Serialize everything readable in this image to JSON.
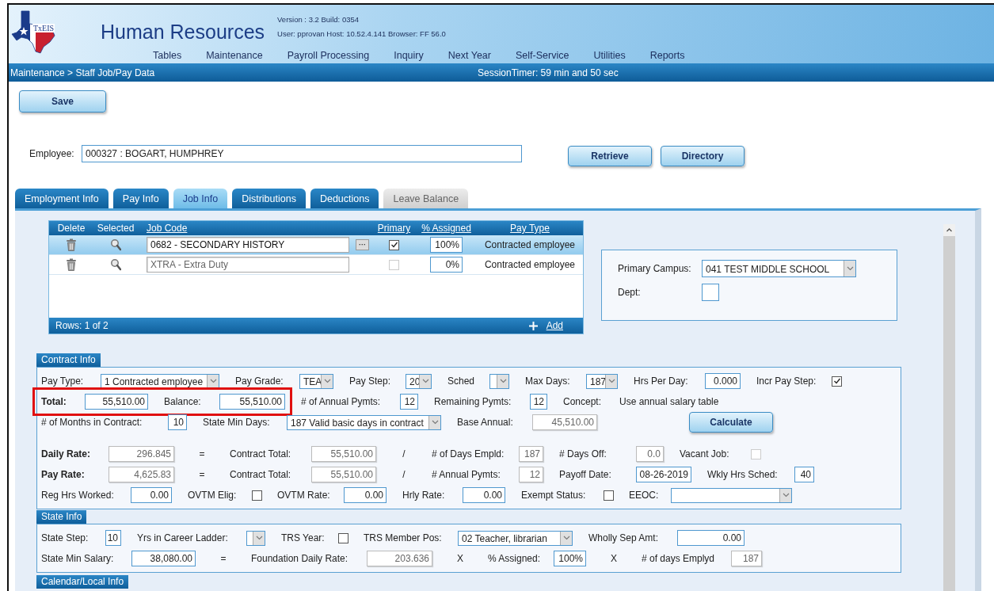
{
  "header": {
    "logo_text": "TxEIS",
    "title": "Human Resources",
    "version": "Version : 3.2 Build: 0354",
    "user_info": "User: pprovan Host: 10.52.4.141 Browser: FF 56.0"
  },
  "menu": [
    "Tables",
    "Maintenance",
    "Payroll Processing",
    "Inquiry",
    "Next Year",
    "Self-Service",
    "Utilities",
    "Reports"
  ],
  "breadcrumb": "Maintenance > Staff Job/Pay Data",
  "session_timer": "SessionTimer: 59 min and 50 sec",
  "save_button": "Save",
  "employee": {
    "label": "Employee:",
    "value": "000327 : BOGART, HUMPHREY"
  },
  "employee_buttons": [
    "Retrieve",
    "Directory"
  ],
  "tabs": [
    {
      "label": "Employment Info",
      "selected": false,
      "disabled": false
    },
    {
      "label": "Pay Info",
      "selected": false,
      "disabled": false
    },
    {
      "label": "Job Info",
      "selected": true,
      "disabled": false
    },
    {
      "label": "Distributions",
      "selected": false,
      "disabled": false
    },
    {
      "label": "Deductions",
      "selected": false,
      "disabled": false
    },
    {
      "label": "Leave Balance",
      "selected": false,
      "disabled": true
    }
  ],
  "job_table": {
    "columns": [
      {
        "label": "Delete",
        "sortable": false
      },
      {
        "label": "Selected",
        "sortable": false
      },
      {
        "label": "Job Code",
        "sortable": true
      },
      {
        "label": "Primary",
        "sortable": true
      },
      {
        "label": "% Assigned",
        "sortable": true
      },
      {
        "label": "Pay Type",
        "sortable": true
      }
    ],
    "rows": [
      {
        "job_code": "0682 - SECONDARY HISTORY",
        "lookup": "···",
        "primary_checked": true,
        "assigned": "100%",
        "pay_type": "Contracted employee",
        "selected": true,
        "disabled": false
      },
      {
        "job_code": "XTRA - Extra Duty",
        "primary_checked": false,
        "assigned": "0%",
        "pay_type": "Contracted employee",
        "selected": false,
        "disabled": true
      }
    ],
    "footer": "Rows: 1 of 2",
    "add_link": "Add"
  },
  "campus": {
    "label": "Primary Campus:",
    "value": "041 TEST MIDDLE SCHOOL",
    "dept_label": "Dept:"
  },
  "contract_info": {
    "title": "Contract Info",
    "rows": [
      {
        "items": [
          {
            "label": "Pay Type:",
            "kind": "select",
            "value": "1 Contracted employee"
          },
          {
            "label": "Pay Grade:",
            "kind": "select",
            "value": "TEA"
          },
          {
            "label": "Pay Step:",
            "kind": "select",
            "value": "20"
          },
          {
            "label": "Sched",
            "kind": "select"
          },
          {
            "label": "Max Days:",
            "kind": "select",
            "value": "187"
          },
          {
            "label": "Hrs Per Day:",
            "kind": "field",
            "value": "0.000"
          },
          {
            "label": "Incr Pay Step:",
            "kind": "check",
            "checked": true,
            "disabled": false
          }
        ]
      },
      {
        "highlight": true,
        "items": [
          {
            "label": "Total:",
            "bold": true,
            "kind": "field",
            "value": "55,510.00"
          },
          {
            "label": "Balance:",
            "kind": "field",
            "value": "55,510.00"
          },
          {
            "label": "# of Annual Pymts:",
            "kind": "field",
            "value": "12"
          },
          {
            "label": "Remaining Pymts:",
            "kind": "field",
            "value": "12"
          },
          {
            "label": "Concept:",
            "kind": "text",
            "value": "Use annual salary table"
          }
        ]
      },
      {
        "items": [
          {
            "label": "# of Months in Contract:",
            "kind": "field",
            "value": "10"
          },
          {
            "label": "State Min Days:",
            "kind": "select",
            "value": "187 Valid basic days in contract"
          },
          {
            "label": "Base Annual:",
            "kind": "readonly",
            "value": "45,510.00"
          },
          {
            "kind": "button",
            "text": "Calculate"
          }
        ]
      },
      {
        "items": [
          {
            "label": "Daily Rate:",
            "bold": true,
            "kind": "readonly",
            "value": "296.845"
          },
          {
            "kind": "op",
            "text": "="
          },
          {
            "label": "Contract Total:",
            "kind": "readonly",
            "value": "55,510.00"
          },
          {
            "kind": "op",
            "text": "/"
          },
          {
            "label": "# of Days Empld:",
            "kind": "readonly",
            "value": "187"
          },
          {
            "label": "# Days Off:",
            "kind": "readonly",
            "value": "0.0"
          },
          {
            "label": "Vacant Job:",
            "kind": "check",
            "checked": false,
            "disabled": true
          }
        ]
      },
      {
        "items": [
          {
            "label": "Pay Rate:",
            "bold": true,
            "kind": "readonly",
            "value": "4,625.83"
          },
          {
            "kind": "op",
            "text": "="
          },
          {
            "label": "Contract Total:",
            "kind": "readonly",
            "value": "55,510.00"
          },
          {
            "kind": "op",
            "text": "/"
          },
          {
            "label": "# Annual Pymts:",
            "kind": "readonly",
            "value": "12"
          },
          {
            "label": "Payoff Date:",
            "kind": "field",
            "value": "08-26-2019"
          },
          {
            "label": "Wkly Hrs Sched:",
            "kind": "field",
            "value": "40"
          }
        ]
      },
      {
        "items": [
          {
            "label": "Reg Hrs Worked:",
            "kind": "field",
            "value": "0.00"
          },
          {
            "label": "OVTM Elig:",
            "kind": "check",
            "checked": false,
            "disabled": false
          },
          {
            "label": "OVTM Rate:",
            "kind": "field",
            "value": "0.00"
          },
          {
            "label": "Hrly Rate:",
            "kind": "field",
            "value": "0.00"
          },
          {
            "label": "Exempt Status:",
            "kind": "check",
            "checked": false,
            "disabled": false
          },
          {
            "label": "EEOC:",
            "kind": "select"
          }
        ]
      }
    ]
  },
  "state_info": {
    "title": "State Info",
    "rows": [
      {
        "items": [
          {
            "label": "State Step:",
            "kind": "field",
            "value": "10"
          },
          {
            "label": "Yrs in Career Ladder:",
            "kind": "select"
          },
          {
            "label": "TRS Year:",
            "kind": "check",
            "checked": false,
            "disabled": false
          },
          {
            "label": "TRS Member Pos:",
            "kind": "select",
            "value": "02 Teacher, librarian"
          },
          {
            "label": "Wholly Sep Amt:",
            "kind": "field",
            "value": "0.00"
          }
        ]
      },
      {
        "items": [
          {
            "label": "State Min Salary:",
            "kind": "field",
            "value": "38,080.00"
          },
          {
            "kind": "op",
            "text": "="
          },
          {
            "label": "Foundation Daily Rate:",
            "kind": "readonly",
            "value": "203.636"
          },
          {
            "kind": "op",
            "text": "X"
          },
          {
            "label": "% Assigned:",
            "kind": "field",
            "value": "100%"
          },
          {
            "kind": "op",
            "text": "X"
          },
          {
            "label": "# of days Emplyd",
            "kind": "readonly",
            "value": "187"
          }
        ]
      }
    ]
  },
  "calendar_local_info": {
    "title": "Calendar/Local Info"
  }
}
